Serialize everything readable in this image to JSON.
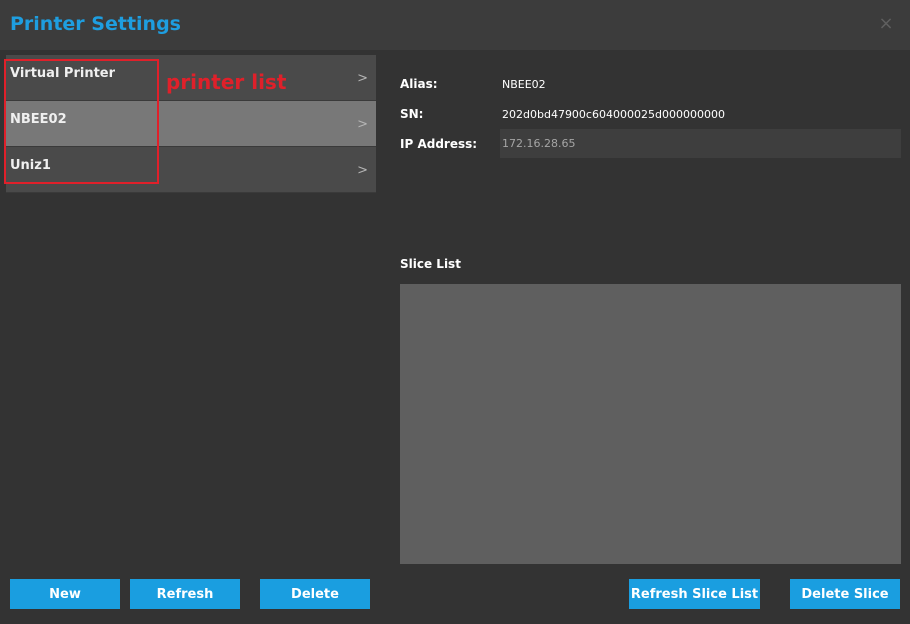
{
  "window": {
    "title": "Printer Settings",
    "close_glyph": "×"
  },
  "printers": [
    {
      "label": "Virtual Printer",
      "selected": false
    },
    {
      "label": "NBEE02",
      "selected": true
    },
    {
      "label": "Uniz1",
      "selected": false
    }
  ],
  "annotation": {
    "text": "printer list",
    "color": "#e0202a"
  },
  "details": {
    "alias_label": "Alias:",
    "alias_value": "NBEE02",
    "sn_label": "SN:",
    "sn_value": "202d0bd47900c604000025d000000000",
    "ip_label": "IP Address:",
    "ip_value": "172.16.28.65"
  },
  "slice": {
    "label": "Slice List"
  },
  "buttons": {
    "new": "New",
    "refresh": "Refresh",
    "delete": "Delete",
    "refresh_slice": "Refresh Slice List",
    "delete_slice": "Delete Slice"
  },
  "colors": {
    "accent": "#1a9ee0",
    "background": "#333333",
    "selected_row": "#787878"
  },
  "icons": {
    "row_chevron": "chevron-right-icon",
    "close": "close-icon"
  }
}
